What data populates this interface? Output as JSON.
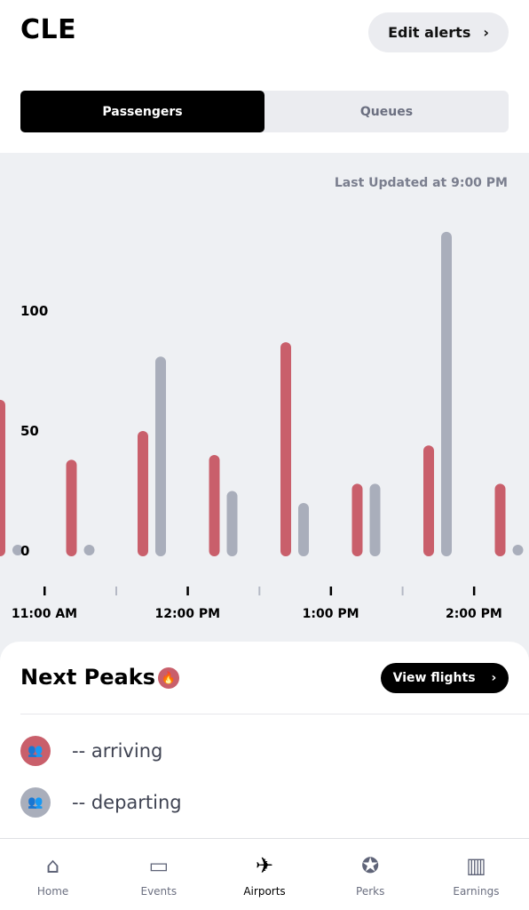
{
  "header": {
    "title": "CLE",
    "edit_alerts": "Edit alerts",
    "chevron": "›"
  },
  "segments": [
    {
      "label": "Passengers",
      "active": true
    },
    {
      "label": "Queues",
      "active": false
    }
  ],
  "last_updated": "Last Updated at 9:00 PM",
  "chart_data": {
    "type": "bar",
    "categories": [
      "10:40 AM",
      "11:10 AM",
      "11:40 AM",
      "12:10 PM",
      "12:40 PM",
      "1:10 PM",
      "1:40 PM",
      "2:10 PM"
    ],
    "series": [
      {
        "key": "arriving",
        "color": "#c95f6b",
        "values": [
          63,
          38,
          50,
          40,
          87,
          28,
          44,
          28
        ]
      },
      {
        "key": "departing",
        "color": "#a9aebb",
        "values": [
          0,
          0,
          81,
          25,
          20,
          28,
          133,
          0
        ]
      }
    ],
    "yticks": [
      "0",
      "50",
      "100"
    ],
    "ylim": [
      0,
      135
    ],
    "xticks": [
      "11:00 AM",
      "12:00 PM",
      "1:00 PM",
      "2:00 PM"
    ],
    "grid": false
  },
  "peaks": {
    "title": "Next Peaks",
    "icon": "fire-icon",
    "view_flights": "View flights",
    "arriving": "-- arriving",
    "departing": "-- departing",
    "arriving_color": "#c95f6b",
    "departing_color": "#a9aebb"
  },
  "tabs": [
    {
      "label": "Home",
      "icon": "home-icon"
    },
    {
      "label": "Events",
      "icon": "calendar-icon"
    },
    {
      "label": "Airports",
      "icon": "airplane-icon",
      "active": true
    },
    {
      "label": "Perks",
      "icon": "award-icon"
    },
    {
      "label": "Earnings",
      "icon": "bar-chart-icon"
    }
  ]
}
